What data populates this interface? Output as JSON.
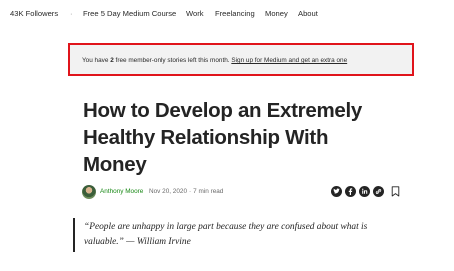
{
  "topnav": {
    "followers": "43K Followers",
    "separator": "·",
    "items": [
      "Free 5 Day Medium Course",
      "Work",
      "Freelancing",
      "Money",
      "About"
    ]
  },
  "banner": {
    "prefix": "You have ",
    "count": "2",
    "suffix": " free member-only stories left this month. ",
    "link": "Sign up for Medium and get an extra one",
    "border_color": "#e0141b"
  },
  "article": {
    "title_lines": [
      "How to Develop an Extremely",
      "Healthy Relationship With",
      "Money"
    ],
    "author": "Anthony Moore",
    "date": "Nov 20, 2020",
    "separator": "·",
    "read_time": "7 min read",
    "share_icons": [
      "twitter-icon",
      "facebook-icon",
      "linkedin-icon",
      "link-icon",
      "bookmark-icon"
    ],
    "quote_lines": [
      "“People are unhappy in large part because they are confused about what is",
      "valuable.” — William Irvine"
    ]
  },
  "colors": {
    "author_green": "#1a8917",
    "text": "#242424",
    "muted": "#6b6b6b",
    "banner_bg": "#f2f2f2"
  }
}
